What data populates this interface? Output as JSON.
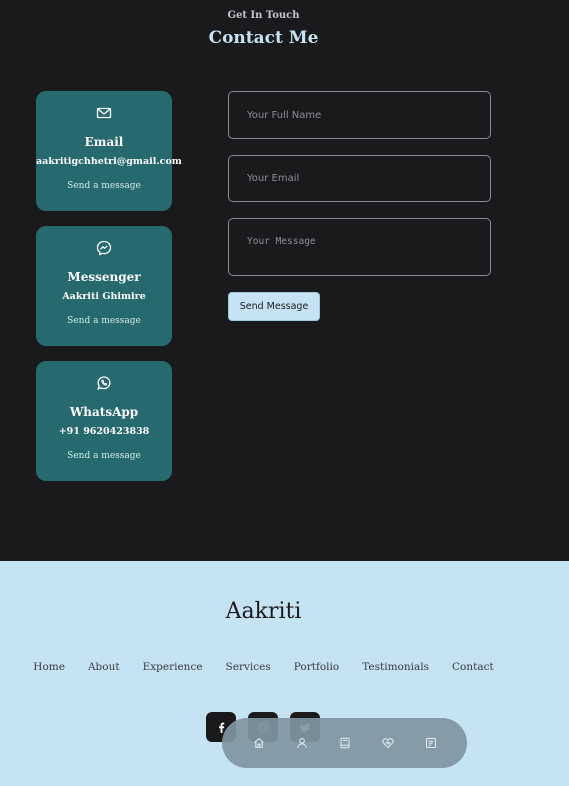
{
  "contact": {
    "subtitle": "Get In Touch",
    "title": "Contact Me",
    "cards": [
      {
        "icon": "mail-icon",
        "title": "Email",
        "value": "aakritigchhetri@gmail.com",
        "link": "Send a message"
      },
      {
        "icon": "messenger-icon",
        "title": "Messenger",
        "value": "Aakriti Ghimire",
        "link": "Send a message"
      },
      {
        "icon": "whatsapp-icon",
        "title": "WhatsApp",
        "value": "+91 9620423838",
        "link": "Send a message"
      }
    ],
    "form": {
      "name_placeholder": "Your Full Name",
      "email_placeholder": "Your Email",
      "message_placeholder": "Your Message",
      "submit_label": "Send Message"
    }
  },
  "footer": {
    "brand": "Aakriti",
    "nav": [
      "Home",
      "About",
      "Experience",
      "Services",
      "Portfolio",
      "Testimonials",
      "Contact"
    ],
    "social": [
      "facebook-icon",
      "instagram-icon",
      "twitter-icon"
    ]
  },
  "floating_nav": {
    "items": [
      "home-icon",
      "user-icon",
      "book-icon",
      "services-icon",
      "message-icon"
    ]
  },
  "colors": {
    "background": "#1a191c",
    "card": "#26696e",
    "accent": "#c5e3f3"
  }
}
